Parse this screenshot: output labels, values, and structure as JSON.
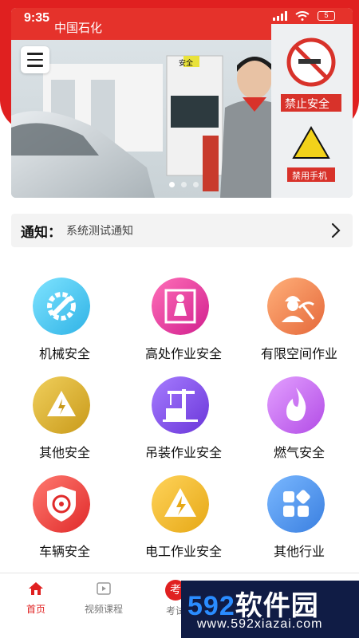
{
  "status_bar": {
    "time": "9:35",
    "battery": "5"
  },
  "banner": {
    "photo_text": {
      "station_brand": "中国石化",
      "no_smoking": "禁止安全",
      "no_phone": "禁用手机",
      "pump_sign": "安全"
    },
    "dots": 3,
    "active_dot": 1
  },
  "notice": {
    "label": "通知：",
    "text": "系统测试通知"
  },
  "grid": [
    {
      "label": "机械安全",
      "icon": "gear-wrench-icon",
      "color_from": "#7fe3ff",
      "color_to": "#2fb3e6"
    },
    {
      "label": "高处作业安全",
      "icon": "worker-height-icon",
      "color_from": "#ff6fb8",
      "color_to": "#d11f8e"
    },
    {
      "label": "有限空间作业",
      "icon": "worker-pickaxe-icon",
      "color_from": "#ffb07a",
      "color_to": "#e5683a"
    },
    {
      "label": "其他安全",
      "icon": "warning-icon",
      "color_from": "#f0cf5c",
      "color_to": "#c99a1a"
    },
    {
      "label": "吊装作业安全",
      "icon": "crane-icon",
      "color_from": "#a67cff",
      "color_to": "#6a36d9"
    },
    {
      "label": "燃气安全",
      "icon": "flame-icon",
      "color_from": "#e3a0ff",
      "color_to": "#b24ce6"
    },
    {
      "label": "车辆安全",
      "icon": "steering-shield-icon",
      "color_from": "#ff7a70",
      "color_to": "#e02a2a"
    },
    {
      "label": "电工作业安全",
      "icon": "electric-warning-icon",
      "color_from": "#ffd35a",
      "color_to": "#e6a816"
    },
    {
      "label": "其他行业",
      "icon": "apps-icon",
      "color_from": "#7ab8ff",
      "color_to": "#3a7fe0"
    }
  ],
  "tabbar": {
    "tabs": [
      {
        "label": "首页",
        "icon": "home-icon",
        "active": true
      },
      {
        "label": "视频课程",
        "icon": "video-icon",
        "active": false
      },
      {
        "label": "考试",
        "icon": "exam-icon",
        "active": false,
        "badge": "考"
      }
    ]
  },
  "watermark": {
    "brand_num": "592",
    "brand_text": "软件园",
    "url": "www.592xiazai.com"
  },
  "colors": {
    "accent": "#e02020",
    "notice_bg": "#f3f3f3",
    "watermark_bg": "#101c45"
  }
}
